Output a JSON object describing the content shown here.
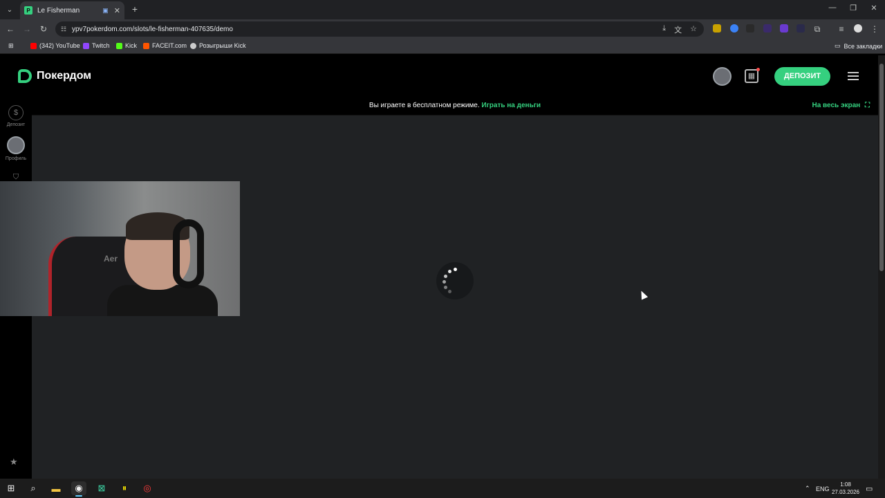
{
  "browser": {
    "tab_title": "Le Fisherman",
    "tab_favicon": "Р",
    "url": "ypv7pokerdom.com/slots/le-fisherman-407635/demo",
    "bookmarks": [
      {
        "label": "(342) YouTube",
        "color": "#ff0000"
      },
      {
        "label": "Twitch",
        "color": "#9146ff"
      },
      {
        "label": "Kick",
        "color": "#53fc18"
      },
      {
        "label": "FACEIT.com",
        "color": "#ff5500"
      },
      {
        "label": "Розыгрыши Kick",
        "color": "#cccccc"
      }
    ],
    "all_bookmarks": "Все закладки"
  },
  "site": {
    "brand": "Покердом",
    "deposit_button": "ДЕПОЗИТ",
    "leftnav": {
      "deposit_label": "Депозит",
      "profile_label": "Профиль"
    },
    "banner": {
      "message": "Вы играете в бесплатном режиме.",
      "play_for_money": "Играть на деньги",
      "fullscreen": "На весь экран"
    },
    "accent_color": "#35d07f"
  },
  "taskbar": {
    "language": "ENG",
    "time": "1:08",
    "date": "27.03.2026"
  }
}
